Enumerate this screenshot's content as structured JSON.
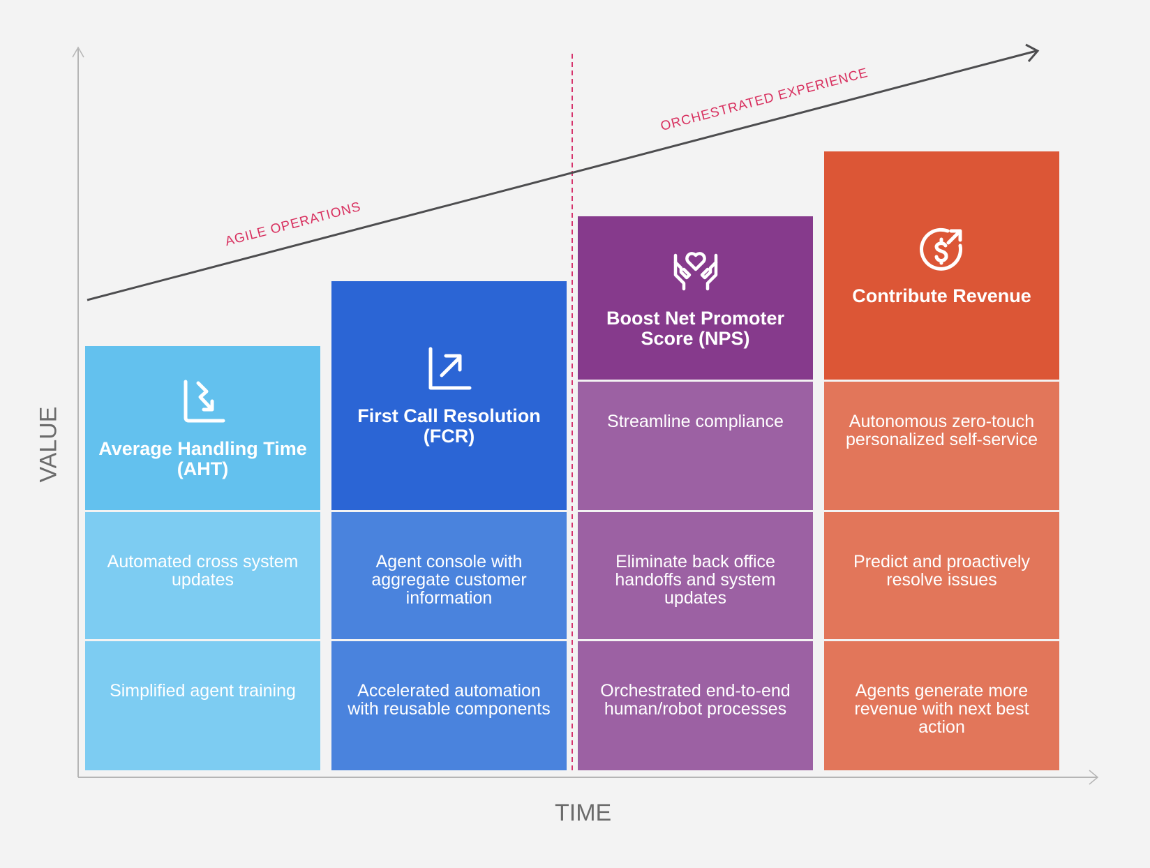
{
  "axes": {
    "x_label": "TIME",
    "y_label": "VALUE"
  },
  "phases": [
    {
      "label": "AGILE OPERATIONS"
    },
    {
      "label": "ORCHESTRATED EXPERIENCE"
    }
  ],
  "colors": {
    "background": "#f3f3f3",
    "axis": "#b5b5b5",
    "trend_line": "#4d4d4f",
    "divider": "#d6336c",
    "phase_text": "#d8305f"
  },
  "columns": [
    {
      "title": "Average Handling Time (AHT)",
      "icon": "chart-trend-down-icon",
      "value_level": 1,
      "header_color": "#63c1ee",
      "cell_color": "#7dccf2",
      "items": [
        "Automated cross system updates",
        "Simplified agent training"
      ]
    },
    {
      "title": "First Call Resolution (FCR)",
      "icon": "chart-trend-up-icon",
      "value_level": 2,
      "header_color": "#2b65d5",
      "cell_color": "#4a83dd",
      "items": [
        "Agent console with aggregate customer information",
        "Accelerated automation with reusable components"
      ]
    },
    {
      "title": "Boost Net Promoter Score (NPS)",
      "icon": "hands-heart-icon",
      "value_level": 3,
      "header_color": "#863a8c",
      "cell_color": "#9c61a3",
      "items": [
        "Streamline compliance",
        "Eliminate back office handoffs and system updates",
        "Orchestrated end-to-end human/robot processes"
      ]
    },
    {
      "title": "Contribute Revenue",
      "icon": "dollar-growth-icon",
      "value_level": 4,
      "header_color": "#dc5636",
      "cell_color": "#e2765a",
      "items": [
        "Autonomous zero-touch personalized self-service",
        "Predict and proactively resolve issues",
        "Agents generate more revenue with next best action"
      ]
    }
  ]
}
